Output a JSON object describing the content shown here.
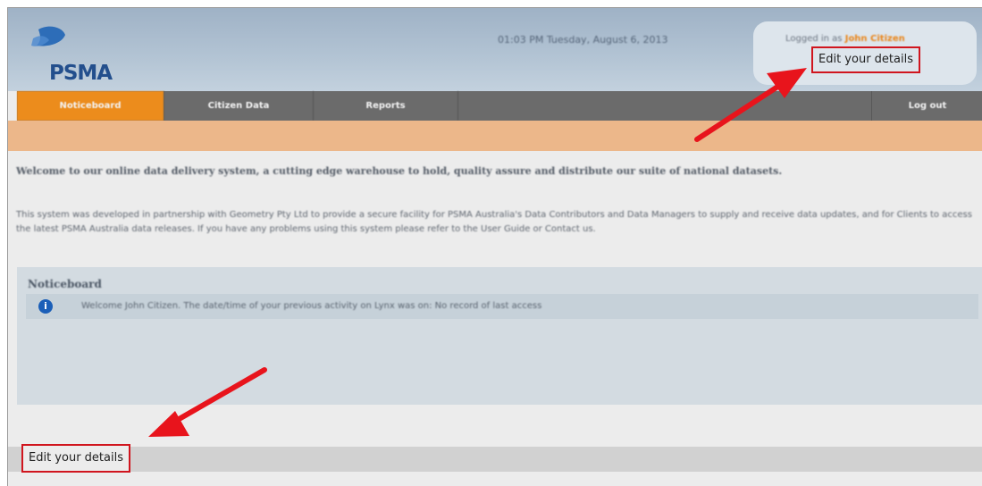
{
  "header": {
    "logo_text": "PSMA",
    "datetime": "01:03 PM Tuesday, August 6, 2013",
    "logged_in_label": "Logged in as",
    "user_name": "John Citizen",
    "edit_details": "Edit your details"
  },
  "nav": {
    "items": [
      {
        "label": "Noticeboard",
        "active": true
      },
      {
        "label": "Citizen Data",
        "active": false
      },
      {
        "label": "Reports",
        "active": false
      }
    ],
    "logout": "Log out"
  },
  "content": {
    "welcome": "Welcome to our online data delivery system, a cutting edge warehouse to hold, quality assure and distribute our suite of national datasets.",
    "intro": "This system was developed in partnership with Geometry Pty Ltd to provide a secure facility for PSMA Australia's Data Contributors and Data Managers to supply and receive data updates, and for Clients to access the latest PSMA Australia data releases. If you have any problems using this system please refer to the User Guide or Contact us."
  },
  "noticeboard": {
    "title": "Noticeboard",
    "message": "Welcome John Citizen. The date/time of your previous activity on Lynx was on: No record of last access"
  },
  "footer": {
    "edit_details": "Edit your details"
  },
  "colors": {
    "accent_orange": "#ec8c1c",
    "highlight_red": "#d0151e",
    "nav_gray": "#6b6b6b",
    "subnav_peach": "#ecb78a"
  },
  "icons": {
    "logo": "psma-logo-icon",
    "info": "info-icon",
    "annotation": "red-arrow-icon"
  }
}
